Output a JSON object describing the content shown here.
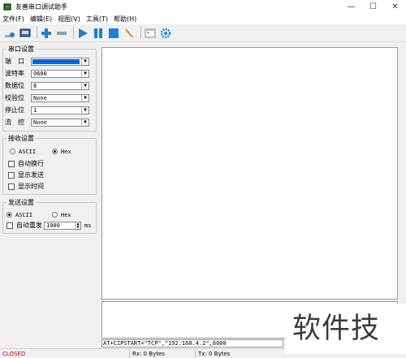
{
  "window": {
    "title": "友善串口调试助手",
    "controls": {
      "minimize": "—",
      "maximize": "☐",
      "close": "✕"
    }
  },
  "menu": [
    "文件(F)",
    "编辑(E)",
    "视图(V)",
    "工具(T)",
    "帮助(H)"
  ],
  "toolbar": {
    "icons": [
      "new-session-icon",
      "serial-port-icon",
      "add-icon",
      "remove-icon",
      "play-icon",
      "pause-icon",
      "stop-icon",
      "clear-icon",
      "window-icon",
      "settings-gear-icon"
    ]
  },
  "serial_settings": {
    "title": "串口设置",
    "fields": [
      {
        "label": "端　口",
        "value": ""
      },
      {
        "label": "波特率",
        "value": "9600"
      },
      {
        "label": "数据位",
        "value": "8"
      },
      {
        "label": "校验位",
        "value": "None"
      },
      {
        "label": "停止位",
        "value": "1"
      },
      {
        "label": "流　控",
        "value": "None"
      }
    ]
  },
  "receive_settings": {
    "title": "接收设置",
    "mode_ascii": "ASCII",
    "mode_hex": "Hex",
    "selected_mode": "Hex",
    "options": [
      "自动换行",
      "显示发送",
      "显示时间"
    ]
  },
  "send_settings": {
    "title": "发送设置",
    "mode_ascii": "ASCII",
    "mode_hex": "Hex",
    "selected_mode": "ASCII",
    "auto_resend_label": "自动重发",
    "interval_value": "1000",
    "interval_unit": "ms"
  },
  "command_line": "AT+CIPSTART=\"TCP\",\"192.168.4.2\",6000",
  "status": {
    "port_state": "CLOSED",
    "rx": "Rx: 0 Bytes",
    "tx": "Tx: 0 Bytes"
  },
  "watermark": "软件技巧",
  "colors": {
    "closed_status": "#d00000",
    "selection": "#0a64d6",
    "toolbar_blue": "#1e7fd0"
  }
}
